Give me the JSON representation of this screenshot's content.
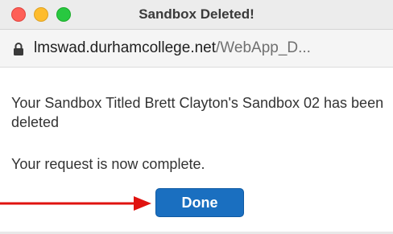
{
  "window": {
    "title": "Sandbox Deleted!"
  },
  "urlbar": {
    "host": "lmswad.durhamcollege.net",
    "path": "/WebApp_D..."
  },
  "content": {
    "message": "Your Sandbox Titled Brett Clayton's Sandbox 02 has been deleted",
    "complete": "Your request is now complete.",
    "done_label": "Done"
  },
  "colors": {
    "button": "#1a6fc0",
    "arrow": "#e0120f"
  },
  "icons": {
    "lock": "lock-icon",
    "arrow": "red-arrow-icon"
  }
}
